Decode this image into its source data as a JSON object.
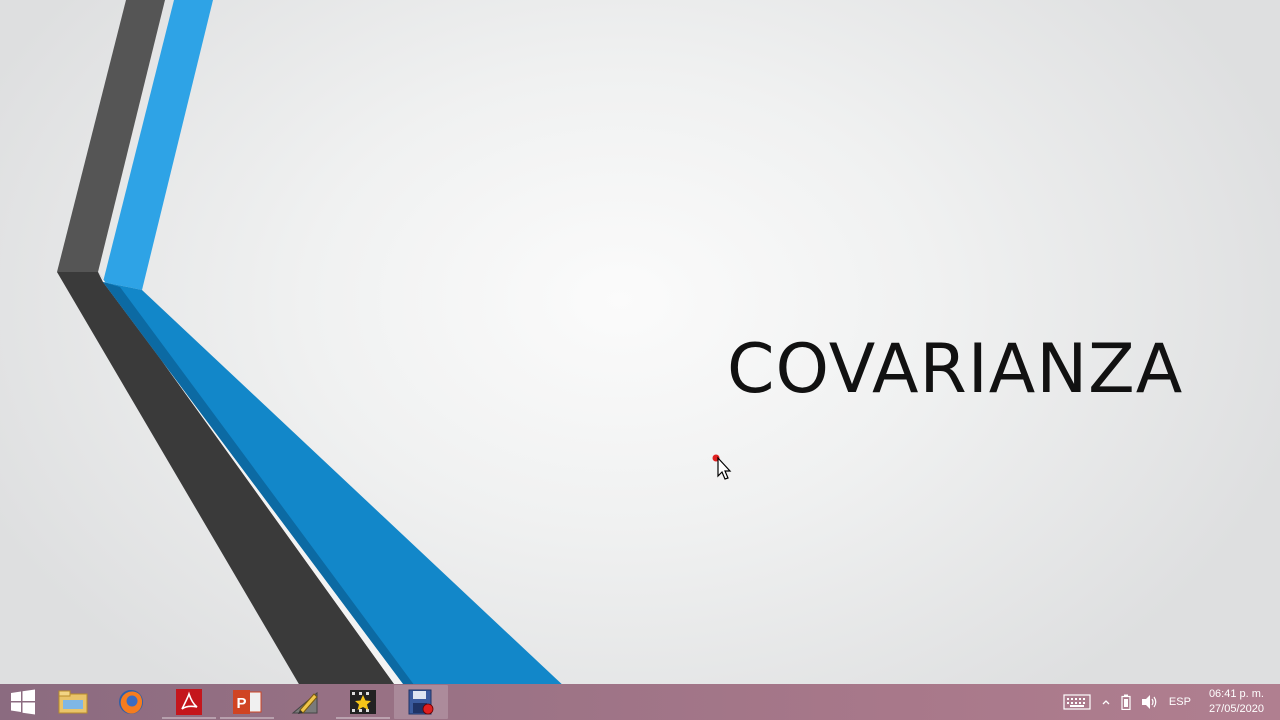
{
  "slide": {
    "title": "COVARIANZA"
  },
  "taskbar": {
    "apps": [
      {
        "name": "file-explorer",
        "icon": "folder-icon"
      },
      {
        "name": "firefox",
        "icon": "firefox-icon"
      },
      {
        "name": "acrobat",
        "icon": "acrobat-icon"
      },
      {
        "name": "powerpoint",
        "icon": "powerpoint-icon"
      },
      {
        "name": "paint-tool",
        "icon": "pencil-ruler-icon"
      },
      {
        "name": "movie-maker",
        "icon": "film-star-icon"
      },
      {
        "name": "screen-recorder",
        "icon": "floppy-record-icon"
      }
    ],
    "tray": {
      "language": "ESP",
      "time": "06:41 p. m.",
      "date": "27/05/2020"
    }
  },
  "colors": {
    "accent_blue": "#2ea3e6",
    "dark_stripe": "#3e3e3e",
    "taskbar": "#9a7285"
  }
}
